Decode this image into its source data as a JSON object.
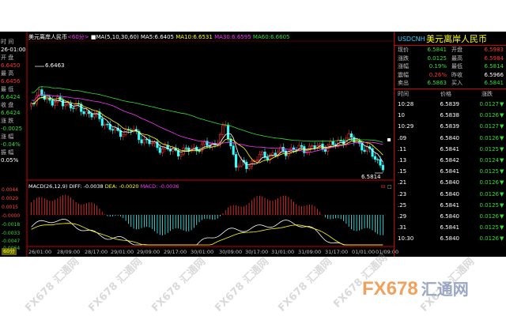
{
  "chart_header": {
    "title": "美元离岸人民币",
    "period_tag": "<60分>",
    "ma_params": "MA(5,10,30,60)",
    "ma5": "MA5:6.6405",
    "ma10": "MA10:6.6531",
    "ma30": "MA30:6.6595",
    "ma60": "MA60:6.6605"
  },
  "left_info": {
    "time_label": "时 间",
    "time_value": "26-01:00",
    "open_label": "开 盘",
    "open_value": "6.6450",
    "high_label": "最 高",
    "high_value": "6.6456",
    "low_label": "最 低",
    "low_value": "6.6424",
    "close_label": "收 盘",
    "close_value": "6.6424",
    "change_label": "涨 跌",
    "change_value": "-0.0025",
    "pct_label": "涨 幅",
    "pct_value": "-0.04%",
    "amp_label": "振 幅",
    "amp_value": "0.05%"
  },
  "annotations": {
    "high_mark": "6.6463",
    "low_mark": "6.5814"
  },
  "indicator": {
    "label": "MACD(26,12,9)",
    "diff": "DIFF: -0.0038",
    "dea": "DEA: -0.0020",
    "macd": "MACD: -0.0036",
    "yticks": [
      "0.0044",
      "0.0029",
      "0.0015",
      "-0.0000",
      "-0.0018",
      "-0.0033",
      "-0.0047",
      "-0.0064"
    ]
  },
  "x_axis_labels": [
    "26/01:00",
    "28/09:00",
    "28/17:00",
    "29/01:00",
    "29/09:00",
    "29/17:00",
    "30/01:00",
    "30/09:00",
    "30/17:00",
    "31/01:00",
    "31/09:00",
    "31/17:00",
    "01/01:00",
    "01/09:00"
  ],
  "period_button": "60分",
  "quote_panel": {
    "symbol": "USDCNH",
    "name": "美元离岸人民币",
    "rows": [
      {
        "l1": "现价",
        "v1": "6.5841",
        "c1": "#33dd33",
        "l2": "开盘",
        "v2": "6.5983",
        "c2": "#ff3333"
      },
      {
        "l1": "涨跌",
        "v1": "0.0125",
        "c1": "#33dd33",
        "l2": "最高",
        "v2": "6.5984",
        "c2": "#ff3333"
      },
      {
        "l1": "涨幅",
        "v1": "0.19%",
        "c1": "#33dd33",
        "l2": "最低",
        "v2": "6.5814",
        "c2": "#33dd33"
      },
      {
        "l1": "震幅",
        "v1": "0.26%",
        "c1": "#ff3333",
        "l2": "昨收",
        "v2": "6.5966",
        "c2": "#ffffff"
      },
      {
        "l1": "卖出",
        "v1": "6.5863",
        "c1": "#33dd33",
        "l2": "买入",
        "v2": "6.5841",
        "c2": "#33dd33"
      }
    ],
    "ticks_header": {
      "time": "时间",
      "price": "价格",
      "change": "涨跌"
    },
    "ticks": [
      {
        "time": "10:28",
        "price": "6.5839",
        "change": "0.0127"
      },
      {
        "time": "10",
        "price": "6.5838",
        "change": "0.0126"
      },
      {
        "time": "10:29",
        "price": "6.5839",
        "change": "0.0127"
      },
      {
        "time": ".09",
        "price": "6.5840",
        "change": "0.0126"
      },
      {
        "time": ".11",
        "price": "6.5841",
        "change": "0.0125"
      },
      {
        "time": ".13",
        "price": "6.5842",
        "change": "0.0124"
      },
      {
        "time": ".15",
        "price": "6.5841",
        "change": "0.0125"
      },
      {
        "time": ".21",
        "price": "6.5840",
        "change": "0.0126"
      },
      {
        "time": ".23",
        "price": "6.5840",
        "change": "0.0126"
      },
      {
        "time": ".25",
        "price": "6.5841",
        "change": "0.0125"
      },
      {
        "time": ".29",
        "price": "6.5840",
        "change": "0.0126"
      },
      {
        "time": ".31",
        "price": "6.5841",
        "change": "0.0125"
      },
      {
        "time": "10:30",
        "price": "6.5840",
        "change": "0.0126"
      }
    ]
  },
  "watermark": {
    "text": "FX678 汇通网",
    "brand_fx": "FX678",
    "brand_cn": "汇通网"
  },
  "chart_data": {
    "type": "candlestick",
    "title": "美元离岸人民币 60分",
    "price_high_mark": 6.6463,
    "price_low_mark": 6.5814,
    "series": [
      {
        "name": "MA5",
        "value_last": 6.6405,
        "color": "#ffffff"
      },
      {
        "name": "MA10",
        "value_last": 6.6531,
        "color": "#ffff00"
      },
      {
        "name": "MA30",
        "value_last": 6.6595,
        "color": "#ff33ff"
      },
      {
        "name": "MA60",
        "value_last": 6.6605,
        "color": "#33dd33"
      }
    ],
    "macd": {
      "params": "26,12,9",
      "diff": -0.0038,
      "dea": -0.002,
      "macd": -0.0036
    }
  }
}
